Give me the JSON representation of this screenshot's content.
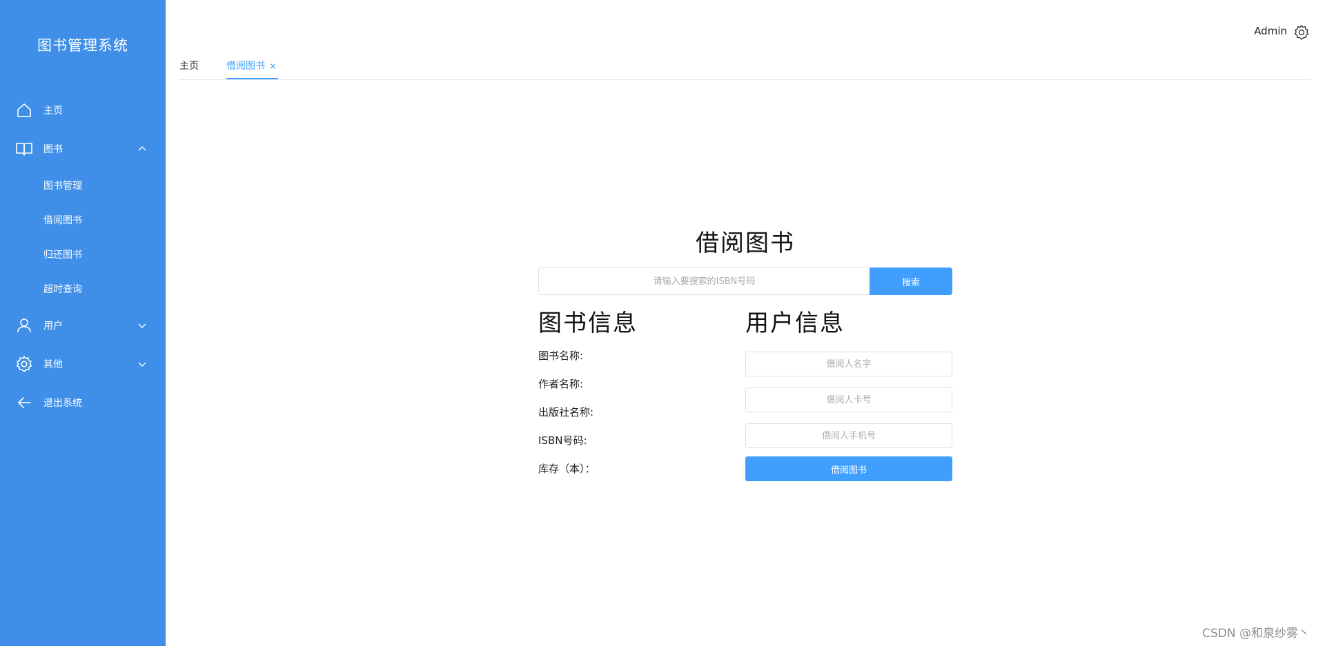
{
  "app": {
    "title": "图书管理系统"
  },
  "sidebar": {
    "items": [
      {
        "label": "主页",
        "icon": "home-icon"
      },
      {
        "label": "图书",
        "icon": "book-icon",
        "expanded": true,
        "children": [
          "图书管理",
          "借阅图书",
          "归还图书",
          "超时查询"
        ]
      },
      {
        "label": "用户",
        "icon": "user-icon",
        "expanded": false
      },
      {
        "label": "其他",
        "icon": "gear-icon",
        "expanded": false
      },
      {
        "label": "退出系统",
        "icon": "arrow-left-icon"
      }
    ]
  },
  "header": {
    "user": "Admin",
    "settings_icon": "gear-icon"
  },
  "tabs": [
    {
      "label": "主页",
      "active": false
    },
    {
      "label": "借阅图书",
      "active": true,
      "closable": true,
      "close_glyph": "×"
    }
  ],
  "main": {
    "title": "借阅图书",
    "search": {
      "placeholder": "请输入要搜索的ISBN号码",
      "button_label": "搜索"
    },
    "book_info": {
      "title": "图书信息",
      "fields": [
        "图书名称:",
        "作者名称:",
        "出版社名称:",
        "ISBN号码:",
        "库存（本）："
      ]
    },
    "user_info": {
      "title": "用户信息",
      "name_placeholder": "借阅人名字",
      "card_placeholder": "借阅人卡号",
      "phone_placeholder": "借阅人手机号",
      "submit_label": "借阅图书"
    }
  },
  "watermark": "CSDN @和泉纱雾丶",
  "colors": {
    "sidebar_bg": "#3f8fe9",
    "primary": "#409eff",
    "text": "#222222",
    "border": "#dcdfe6"
  }
}
